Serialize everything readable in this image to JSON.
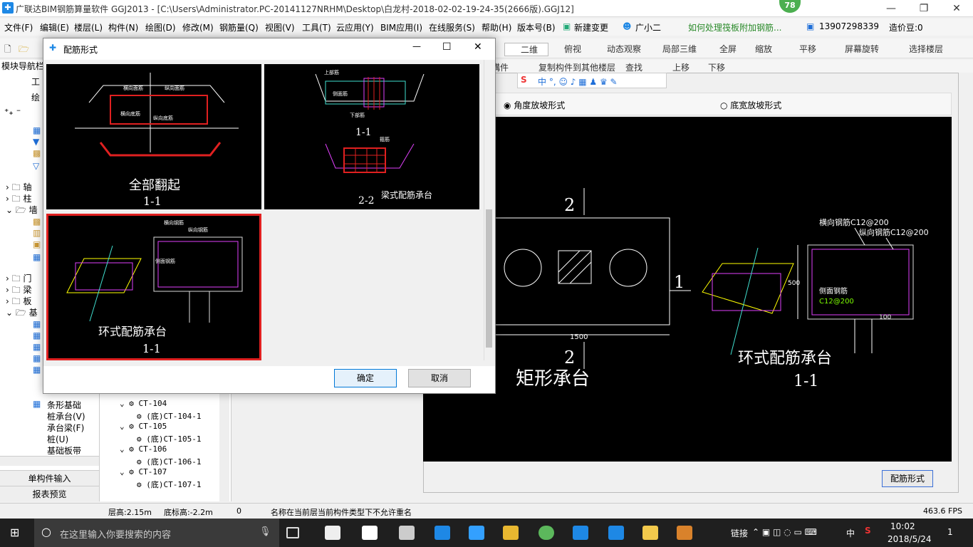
{
  "window": {
    "title": "广联达BIM钢筋算量软件 GGJ2013 - [C:\\Users\\Administrator.PC-20141127NRHM\\Desktop\\白龙村-2018-02-02-19-24-35(2666版).GGJ12]",
    "badge": "78",
    "minimize": "—",
    "restore": "❐",
    "close": "✕"
  },
  "menu": [
    "文件(F)",
    "编辑(E)",
    "楼层(L)",
    "构件(N)",
    "绘图(D)",
    "修改(M)",
    "钢筋量(Q)",
    "视图(V)",
    "工具(T)",
    "云应用(Y)",
    "BIM应用(I)",
    "在线服务(S)",
    "帮助(H)",
    "版本号(B)"
  ],
  "menu_right": {
    "new_change": "新建变更",
    "assistant": "广小二",
    "tip_link": "如何处理筏板附加钢筋...",
    "phone": "13907298339",
    "beans": "造价豆:0"
  },
  "toolbar": {
    "view_mode": "二维",
    "top_view": "俯视",
    "dynamic_view": "动态观察",
    "local_3d": "局部三维",
    "full_screen": "全屏",
    "zoom": "缩放",
    "pan": "平移",
    "rotate": "屏幕旋转",
    "select_floor": "选择楼层"
  },
  "toolbar2": {
    "component": "構件",
    "copy_to_other": "复制构件到其他楼层",
    "find": "查找",
    "up": "上移",
    "down": "下移"
  },
  "left_panel": {
    "nav_title": "模块导航栏",
    "tab1": "工",
    "tab2": "绘",
    "tree": [
      "轴",
      "柱",
      "墙",
      "门",
      "梁",
      "板",
      "基"
    ],
    "foundation_items": [
      "条形基础",
      "桩承台(V)",
      "承台梁(F)",
      "桩(U)",
      "基础板带"
    ],
    "single_input": "单构件输入",
    "report": "报表预览"
  },
  "tree_items": [
    "CT-104",
    "(底)CT-104-1",
    "CT-105",
    "(底)CT-105-1",
    "CT-106",
    "(底)CT-106-1",
    "CT-107",
    "(底)CT-107-1"
  ],
  "right_panel": {
    "radio_angle": "角度放坡形式",
    "radio_width": "底宽放坡形式",
    "rebar_btn": "配筋形式",
    "cad": {
      "sec_top": "2",
      "sec_bottom": "2",
      "sec_right": "1",
      "dim_1500": "1500",
      "title_rect": "矩形承台",
      "h_bar": "横向钢筋C12@200",
      "v_bar": "纵向钢筋C12@200",
      "side_bar": "侧面钢筋",
      "side_spec": "C12@200",
      "dim_500": "500",
      "dim_100": "100",
      "title_ring": "环式配筋承台",
      "sub_11": "1-1"
    }
  },
  "dialog": {
    "title": "配筋形式",
    "thumbs": [
      {
        "title": "全部翻起",
        "sub": "1-1",
        "l1": "横向面筋",
        "l2": "纵向面筋",
        "l3": "横向底筋",
        "l4": "纵向底筋"
      },
      {
        "title": "梁式配筋承台",
        "sub1": "1-1",
        "sub2": "2-2",
        "l1": "上部筋",
        "l2": "侧面筋",
        "l3": "下部筋",
        "l4": "箍筋"
      },
      {
        "title": "环式配筋承台",
        "sub": "1-1",
        "l1": "横向钢筋",
        "l2": "纵向钢筋",
        "l3": "侧面钢筋"
      }
    ],
    "ok": "确定",
    "cancel": "取消"
  },
  "status": {
    "floor_height": "层高:2.15m",
    "base_elev": "底标高:-2.2m",
    "zero": "0",
    "message": "名称在当前层当前构件类型下不允许重名",
    "fps": "463.6 FPS"
  },
  "taskbar": {
    "search_placeholder": "在这里输入你要搜索的内容",
    "link": "链接",
    "lang": "中",
    "time": "10:02",
    "date": "2018/5/24",
    "notif": "1"
  },
  "colors": {
    "accent": "#0078d7",
    "selected_border": "#e02020",
    "cad_bg": "#000000"
  }
}
